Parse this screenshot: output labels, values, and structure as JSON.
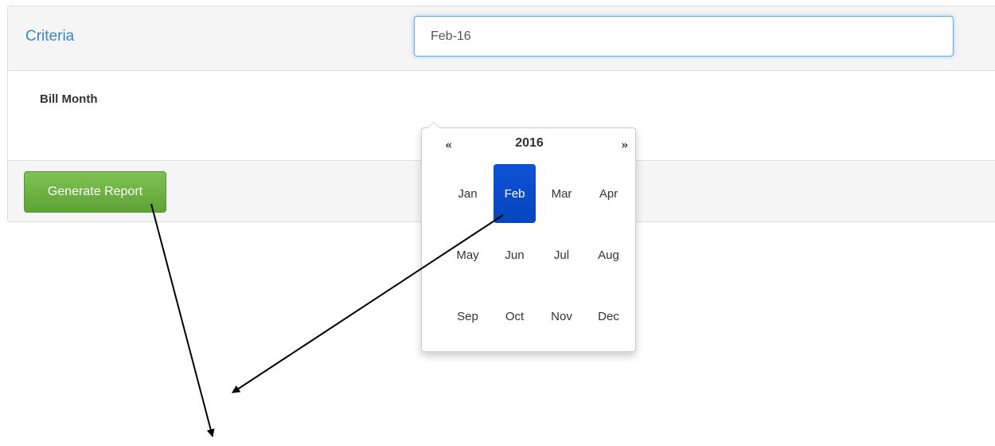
{
  "panel": {
    "title": "Criteria",
    "field_label": "Bill Month",
    "input_value": "Feb-16",
    "button_label": "Generate Report"
  },
  "datepicker": {
    "prev": "«",
    "next": "»",
    "year": "2016",
    "months": [
      "Jan",
      "Feb",
      "Mar",
      "Apr",
      "May",
      "Jun",
      "Jul",
      "Aug",
      "Sep",
      "Oct",
      "Nov",
      "Dec"
    ],
    "selected": "Feb"
  },
  "colors": {
    "accent_title": "#3a87bf",
    "selected_month": "#0a4fcc",
    "button_green": "#6cb044"
  }
}
